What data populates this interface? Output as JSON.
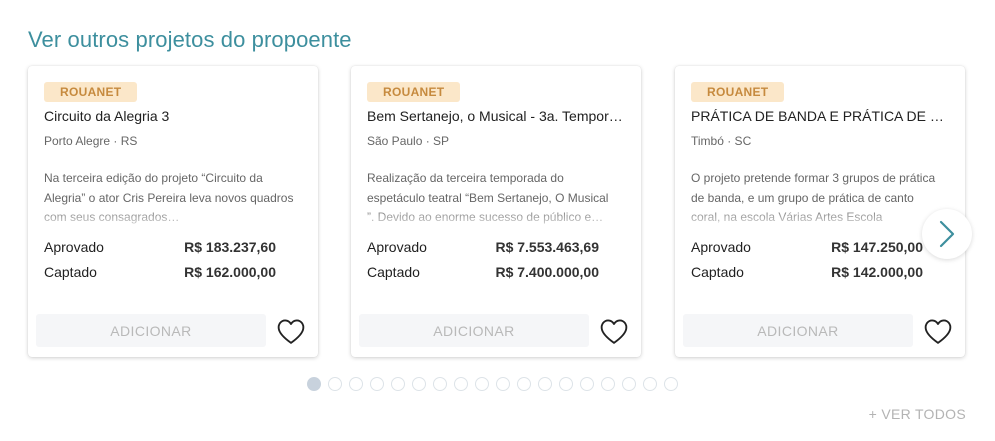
{
  "section": {
    "title": "Ver outros projetos do propoente"
  },
  "cards": [
    {
      "badge": "ROUANET",
      "title": "Circuito da Alegria 3",
      "location": "Porto Alegre · RS",
      "description": "Na terceira edição do projeto “Circuito da Alegria” o ator Cris Pereira leva novos quadros com seus consagrados…",
      "approved_label": "Aprovado",
      "approved_value": "R$ 183.237,60",
      "raised_label": "Captado",
      "raised_value": "R$ 162.000,00",
      "add_label": "ADICIONAR"
    },
    {
      "badge": "ROUANET",
      "title": "Bem Sertanejo, o Musical - 3a. Tempor…",
      "location": "São Paulo · SP",
      "description": "Realização da terceira temporada do espetáculo teatral “Bem Sertanejo, O Musical ”. Devido ao enorme sucesso de público e…",
      "approved_label": "Aprovado",
      "approved_value": "R$ 7.553.463,69",
      "raised_label": "Captado",
      "raised_value": "R$ 7.400.000,00",
      "add_label": "ADICIONAR"
    },
    {
      "badge": "ROUANET",
      "title": "PRÁTICA DE BANDA E PRÁTICA DE CA…",
      "location": "Timbó · SC",
      "description": "O projeto pretende formar 3 grupos de prática de banda, e um grupo de prática de canto coral, na escola Várias Artes Escola",
      "approved_label": "Aprovado",
      "approved_value": "R$ 147.250,00",
      "raised_label": "Captado",
      "raised_value": "R$ 142.000,00",
      "add_label": "ADICIONAR"
    }
  ],
  "icons": {
    "favorite": "heart-outline-icon",
    "next": "chevron-right-icon"
  },
  "pagination": {
    "total": 18,
    "active_index": 0
  },
  "footer": {
    "see_all": "+ VER TODOS"
  },
  "colors": {
    "title": "#3d8f9e",
    "badge_bg": "#fbe7c9",
    "badge_text": "#c68a3e",
    "chevron": "#3d8f9e"
  }
}
